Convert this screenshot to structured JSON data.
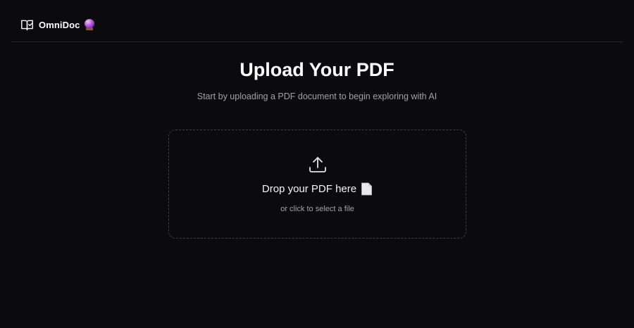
{
  "app": {
    "name": "OmniDoc",
    "brand_icon": "book-open-icon",
    "brand_emoji_icon": "crystal-ball-icon"
  },
  "main": {
    "title": "Upload Your PDF",
    "subtitle": "Start by uploading a PDF document to begin exploring with AI"
  },
  "dropzone": {
    "label": "Drop your PDF here",
    "hint": "or click to select a file",
    "upload_icon": "upload-icon",
    "file_icon": "document-icon"
  },
  "colors": {
    "background": "#0b0b0d",
    "text_primary": "#ffffff",
    "text_muted": "#a1a1aa",
    "border": "#27272a",
    "dropzone_border": "#3f3f46"
  }
}
